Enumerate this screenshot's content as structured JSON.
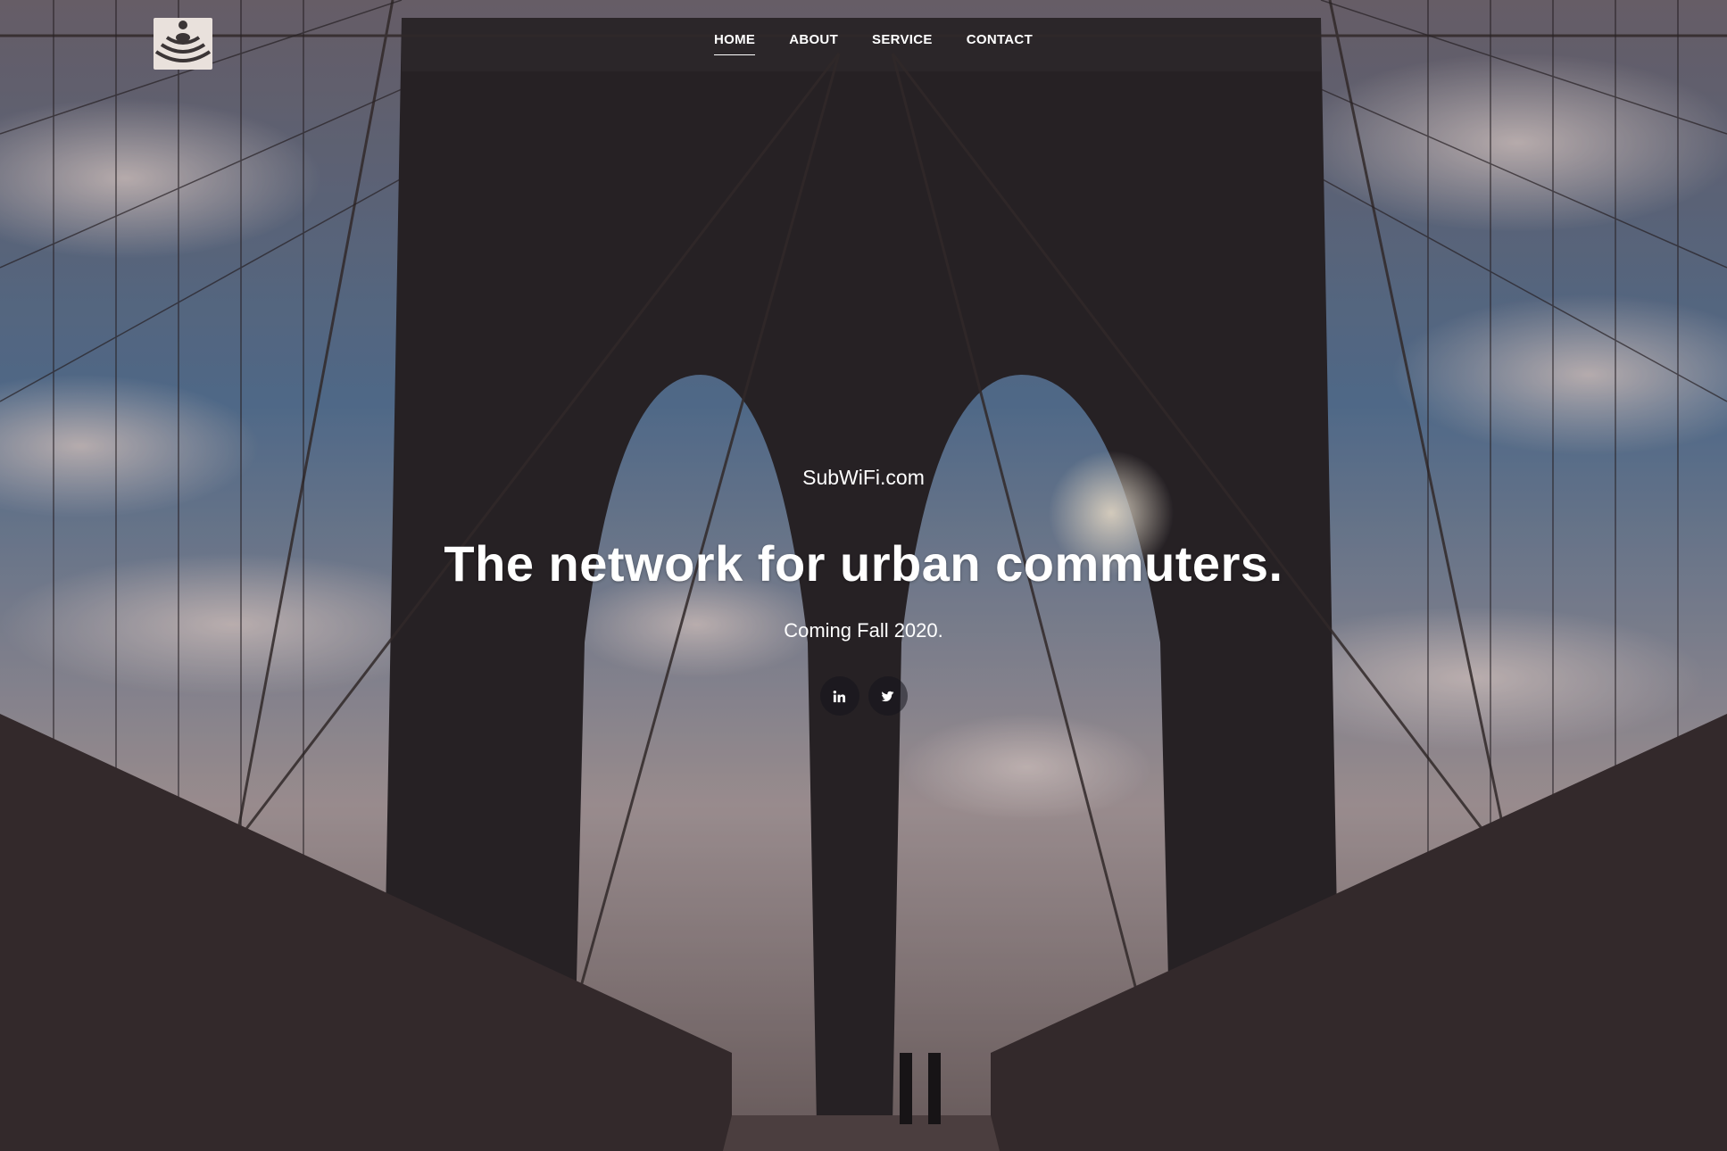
{
  "brand": {
    "logo_icon": "wifi-signal-person-icon",
    "site_name": "SubWiFi.com"
  },
  "nav": {
    "items": [
      {
        "label": "HOME",
        "active": true
      },
      {
        "label": "ABOUT",
        "active": false
      },
      {
        "label": "SERVICE",
        "active": false
      },
      {
        "label": "CONTACT",
        "active": false
      }
    ]
  },
  "hero": {
    "headline": "The network for urban commuters.",
    "subline": "Coming Fall 2020.",
    "background": "brooklyn-bridge-photo"
  },
  "social": [
    {
      "icon": "linkedin-icon"
    },
    {
      "icon": "twitter-icon"
    }
  ],
  "colors": {
    "text": "#ffffff",
    "logo_bg": "#e9e1dc",
    "logo_fg": "#3b3536"
  }
}
